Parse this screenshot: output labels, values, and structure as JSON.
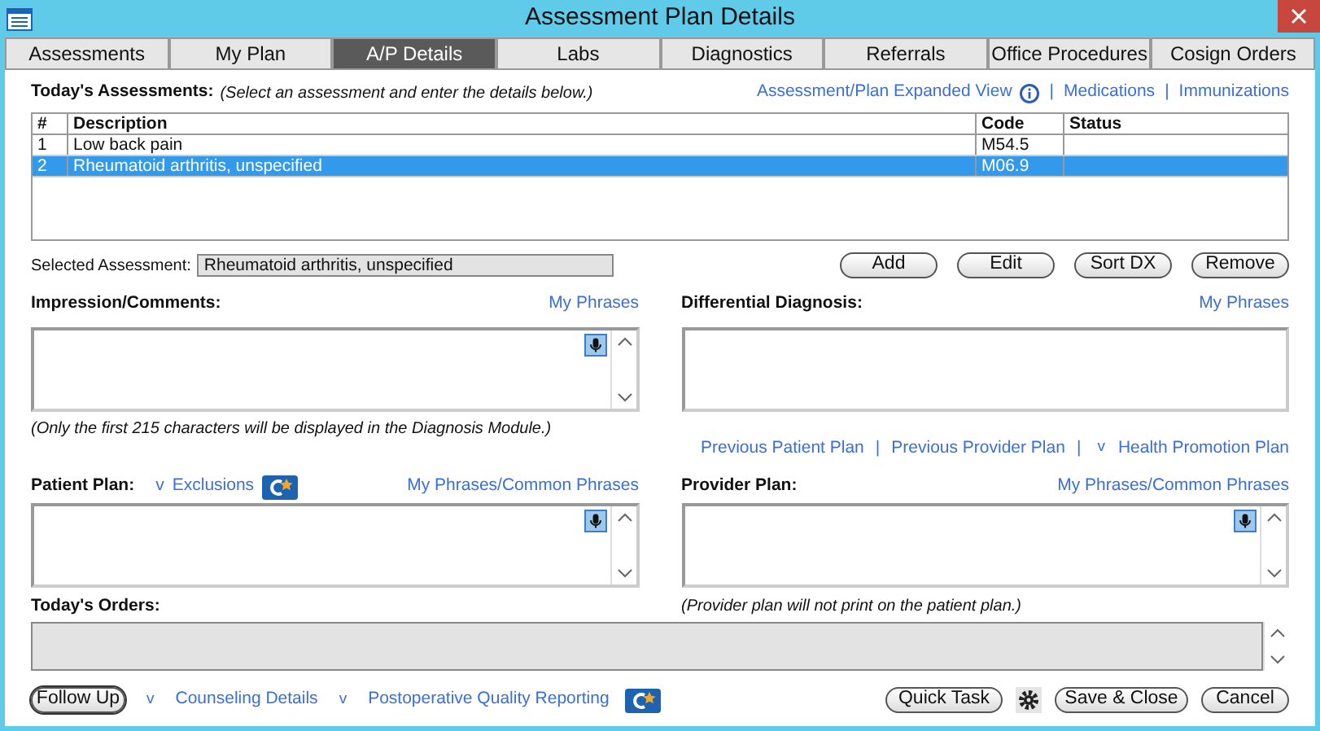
{
  "window": {
    "title": "Assessment Plan Details"
  },
  "tabs": [
    {
      "label": "Assessments",
      "selected": false
    },
    {
      "label": "My Plan",
      "selected": false
    },
    {
      "label": "A/P Details",
      "selected": true
    },
    {
      "label": "Labs",
      "selected": false
    },
    {
      "label": "Diagnostics",
      "selected": false
    },
    {
      "label": "Referrals",
      "selected": false
    },
    {
      "label": "Office Procedures",
      "selected": false
    },
    {
      "label": "Cosign Orders",
      "selected": false
    }
  ],
  "assessments": {
    "label": "Today's Assessments:",
    "hint": "(Select an assessment and enter the details below.)",
    "links": [
      {
        "kind": "link",
        "label": "Assessment/Plan Expanded View"
      },
      {
        "kind": "info"
      },
      {
        "kind": "separator",
        "label": "|"
      },
      {
        "kind": "link",
        "label": "Medications"
      },
      {
        "kind": "separator",
        "label": "|"
      },
      {
        "kind": "link",
        "label": "Immunizations"
      }
    ],
    "columns": [
      "#",
      "Description",
      "Code",
      "Status"
    ],
    "rows": [
      {
        "cells": [
          "1",
          "Low back pain",
          "M54.5"
        ],
        "selected": false
      },
      {
        "cells": [
          "2",
          "Rheumatoid arthritis, unspecified",
          "M06.9"
        ],
        "selected": true
      }
    ]
  },
  "selected_assessment": {
    "label": "Selected Assessment:",
    "value": "Rheumatoid arthritis, unspecified"
  },
  "action_buttons": [
    "Add",
    "Edit",
    "Sort DX",
    "Remove"
  ],
  "impression": {
    "label": "Impression/Comments:",
    "link": "My Phrases",
    "note": "(Only the first 215 characters will be displayed in the Diagnosis Module.)"
  },
  "differential": {
    "label": "Differential Diagnosis:",
    "link": "My Phrases"
  },
  "plan_links": [
    {
      "kind": "link",
      "label": "Previous Patient Plan"
    },
    {
      "kind": "separator",
      "label": "|"
    },
    {
      "kind": "link",
      "label": "Previous Provider Plan"
    },
    {
      "kind": "separator",
      "label": "|"
    },
    {
      "kind": "toggle",
      "label": "v"
    },
    {
      "kind": "link",
      "label": "Health Promotion Plan"
    }
  ],
  "patient_plan": {
    "label": "Patient Plan:",
    "toggle": "v",
    "link": "Exclusions",
    "phrases": "My Phrases/Common Phrases"
  },
  "provider_plan": {
    "label": "Provider Plan:",
    "phrases": "My Phrases/Common Phrases",
    "note": "(Provider plan will not print on the patient plan.)"
  },
  "orders": {
    "label": "Today's Orders:"
  },
  "footer_left": [
    {
      "kind": "button",
      "label": "Follow Up"
    },
    {
      "kind": "toggle",
      "label": "v"
    },
    {
      "kind": "link",
      "label": "Counseling Details"
    },
    {
      "kind": "toggle",
      "label": "v"
    },
    {
      "kind": "link",
      "label": "Postoperative Quality Reporting"
    },
    {
      "kind": "badge"
    }
  ],
  "footer_right": [
    {
      "kind": "button",
      "label": "Quick Task"
    },
    {
      "kind": "gear"
    },
    {
      "kind": "button",
      "label": "Save & Close"
    },
    {
      "kind": "button",
      "label": "Cancel"
    }
  ]
}
